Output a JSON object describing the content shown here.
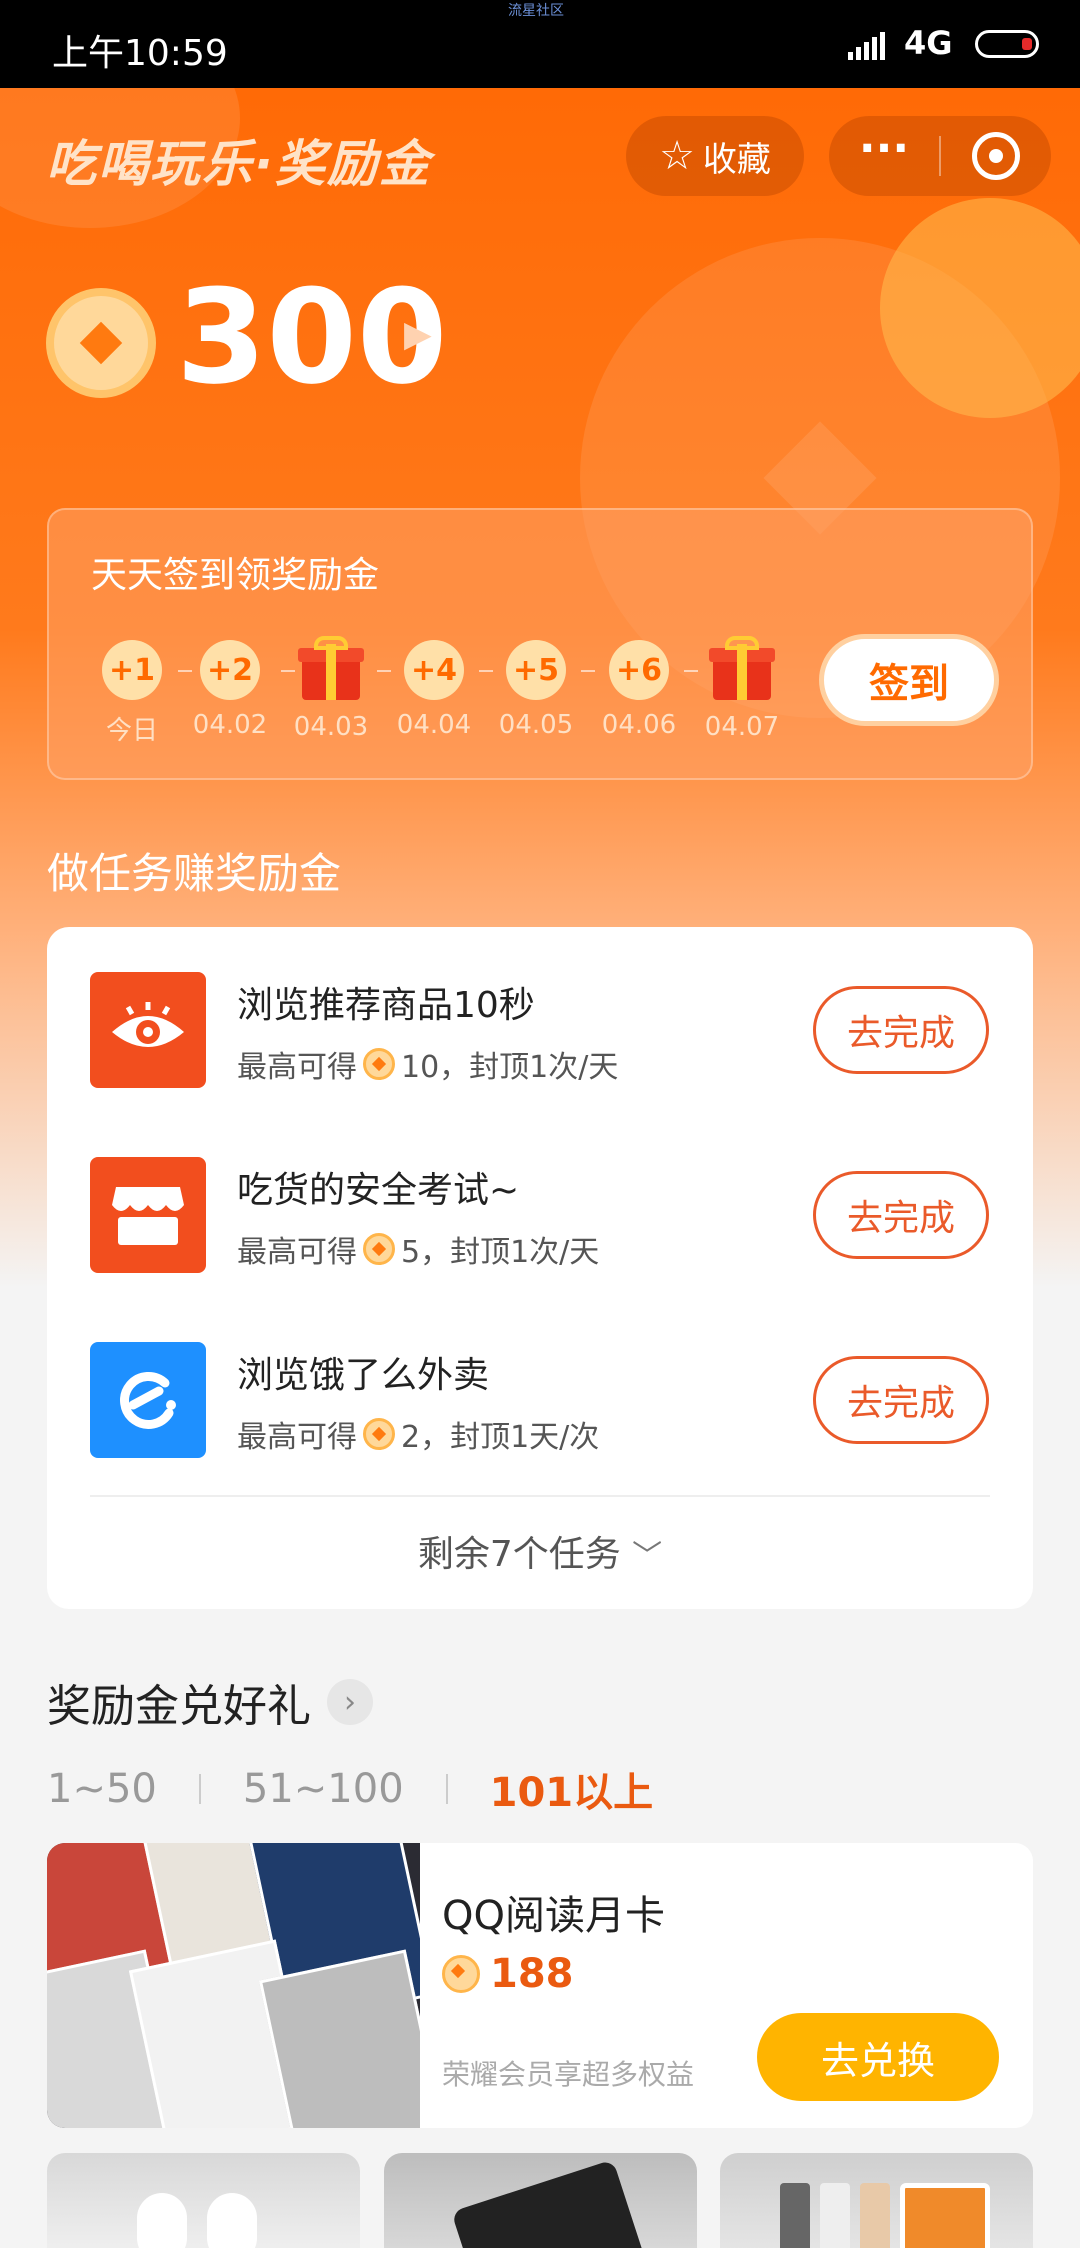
{
  "status_bar": {
    "time": "上午10:59",
    "network": "4G",
    "watermark": "流星社区"
  },
  "header": {
    "title": "吃喝玩乐·奖励金",
    "favorite_label": "收藏",
    "more_label": "···"
  },
  "points": {
    "value": "300"
  },
  "checkin": {
    "title": "天天签到领奖励金",
    "button_label": "签到",
    "days": [
      {
        "reward": "+1",
        "date": "今日",
        "gift": false
      },
      {
        "reward": "+2",
        "date": "04.02",
        "gift": false
      },
      {
        "reward": "",
        "date": "04.03",
        "gift": true
      },
      {
        "reward": "+4",
        "date": "04.04",
        "gift": false
      },
      {
        "reward": "+5",
        "date": "04.05",
        "gift": false
      },
      {
        "reward": "+6",
        "date": "04.06",
        "gift": false
      },
      {
        "reward": "",
        "date": "04.07",
        "gift": true
      }
    ]
  },
  "tasks": {
    "heading": "做任务赚奖励金",
    "items": [
      {
        "name": "浏览推荐商品10秒",
        "desc_prefix": "最高可得",
        "desc_suffix": "10，封顶1次/天",
        "button": "去完成",
        "icon": "eye-icon",
        "color": "#f24e1e"
      },
      {
        "name": "吃货的安全考试~",
        "desc_prefix": "最高可得",
        "desc_suffix": "5，封顶1次/天",
        "button": "去完成",
        "icon": "store-icon",
        "color": "#f24e1e"
      },
      {
        "name": "浏览饿了么外卖",
        "desc_prefix": "最高可得",
        "desc_suffix": "2，封顶1天/次",
        "button": "去完成",
        "icon": "eleme-icon",
        "color": "#1e90ff"
      }
    ],
    "remaining": "剩余7个任务"
  },
  "rewards": {
    "heading": "奖励金兑好礼",
    "ranges": [
      "1~50",
      "51~100",
      "101以上"
    ],
    "product": {
      "name": "QQ阅读月卡",
      "price": "188",
      "desc": "荣耀会员享超多权益",
      "button": "去兑换"
    }
  },
  "colors": {
    "primary": "#ff6a06",
    "accent": "#ea5a10",
    "exchange": "#ffb400"
  }
}
